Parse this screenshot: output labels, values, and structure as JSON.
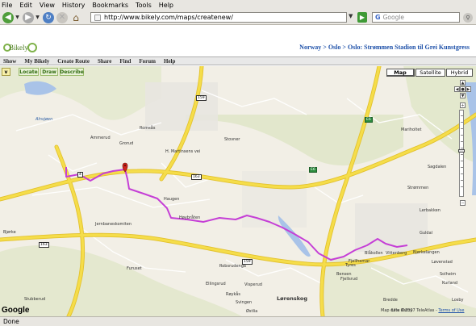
{
  "browser": {
    "menu": [
      "File",
      "Edit",
      "View",
      "History",
      "Bookmarks",
      "Tools",
      "Help"
    ],
    "url": "http://www.bikely.com/maps/createnew/",
    "search_placeholder": "Google",
    "search_engine_icon": "G",
    "status": "Done"
  },
  "site": {
    "logo_text": "Bikely",
    "breadcrumb": "Norway > Oslo > Oslo: Strømmen Stadion til Grei Kunstgress",
    "nav": [
      "Show",
      "My Bikely",
      "Create Route",
      "Share",
      "Find",
      "Forum",
      "Help"
    ]
  },
  "map": {
    "toolbar": {
      "toggle": "v",
      "buttons": [
        "Locate",
        "Draw",
        "Describe"
      ]
    },
    "map_types": [
      "Map",
      "Satellite",
      "Hybrid"
    ],
    "selected_type": "Map",
    "route_color": "#c53fd6",
    "road_color": "#f5dd4a",
    "water_color": "#a9c3e8",
    "places": [
      {
        "name": "Romsås"
      },
      {
        "name": "Ammerud"
      },
      {
        "name": "Grorud"
      },
      {
        "name": "Stovner"
      },
      {
        "name": "H. Martinsens vei"
      },
      {
        "name": "Haugen"
      },
      {
        "name": "Høybråten"
      },
      {
        "name": "Jernbaneskomiten"
      },
      {
        "name": "Furuset"
      },
      {
        "name": "Robsrudenga"
      },
      {
        "name": "Ellingsrud"
      },
      {
        "name": "Røykås"
      },
      {
        "name": "Visperud"
      },
      {
        "name": "Svingen"
      },
      {
        "name": "Lørenskog"
      },
      {
        "name": "Stubberud"
      },
      {
        "name": "Bjørke"
      },
      {
        "name": "Fjellhamar"
      },
      {
        "name": "Blåkollen"
      },
      {
        "name": "Vittenberg"
      },
      {
        "name": "Bjørkelangen"
      },
      {
        "name": "Tyres"
      },
      {
        "name": "Bensen"
      },
      {
        "name": "Fjellsrud"
      },
      {
        "name": "Bredde"
      },
      {
        "name": "Lille Østby"
      },
      {
        "name": "Østlia"
      },
      {
        "name": "Strømmen"
      },
      {
        "name": "Sagdalen"
      },
      {
        "name": "Guldal"
      },
      {
        "name": "Lerbakken"
      },
      {
        "name": "Løvenstad"
      },
      {
        "name": "Solheim"
      },
      {
        "name": "Kurland"
      },
      {
        "name": "Losby"
      },
      {
        "name": "Mariholtet"
      }
    ],
    "water_labels": [
      "Alnsjøen"
    ],
    "road_labels": [
      "163",
      "E6",
      "159",
      "4",
      "E6",
      "163",
      "159"
    ],
    "google_logo": "Google",
    "attribution": "Map data ©2007 TeleAtlas - ",
    "terms": "Terms of Use"
  }
}
